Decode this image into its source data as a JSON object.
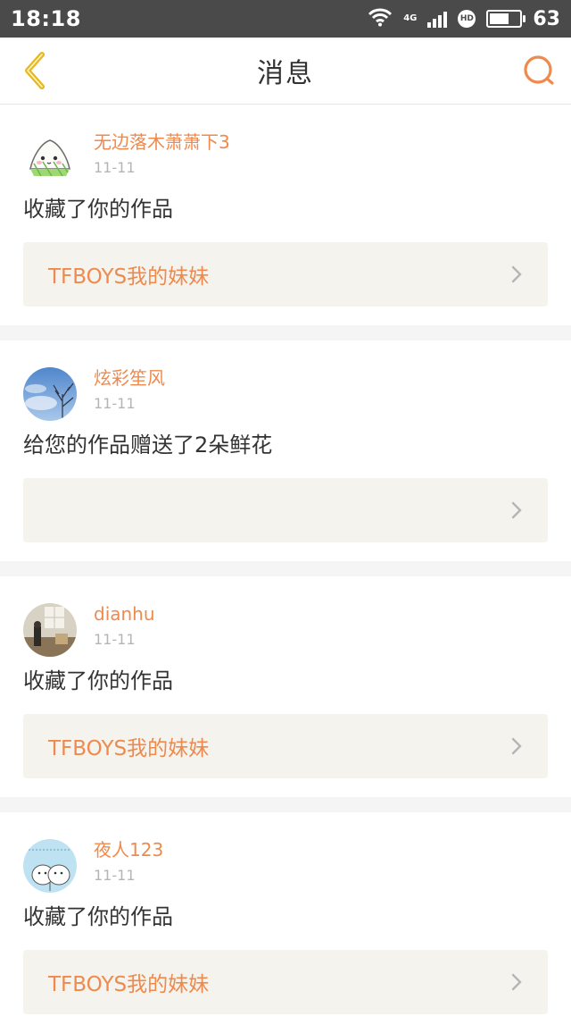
{
  "status_bar": {
    "time": "18:18",
    "network": "4G",
    "hd": "HD",
    "battery": "63",
    "battery_level": 0.63
  },
  "nav": {
    "title": "消息",
    "back_icon": "chevron-left-icon",
    "search_icon": "search-icon"
  },
  "colors": {
    "accent": "#ee8a4d",
    "back_icon": "#e6b820",
    "card_link_bg": "#f4f3ee"
  },
  "messages": [
    {
      "user": "无边落木萧萧下3",
      "date": "11-11",
      "text": "收藏了你的作品",
      "work": "TFBOYS我的妹妹",
      "avatar": "zongzi-cartoon-avatar"
    },
    {
      "user": "炫彩笙风",
      "date": "11-11",
      "text": "给您的作品赠送了2朵鲜花",
      "work": "",
      "avatar": "sky-tree-avatar"
    },
    {
      "user": "dianhu",
      "date": "11-11",
      "text": "收藏了你的作品",
      "work": "TFBOYS我的妹妹",
      "avatar": "room-photo-avatar"
    },
    {
      "user": "夜人123",
      "date": "11-11",
      "text": "收藏了你的作品",
      "work": "TFBOYS我的妹妹",
      "avatar": "cartoon-bears-avatar"
    }
  ]
}
